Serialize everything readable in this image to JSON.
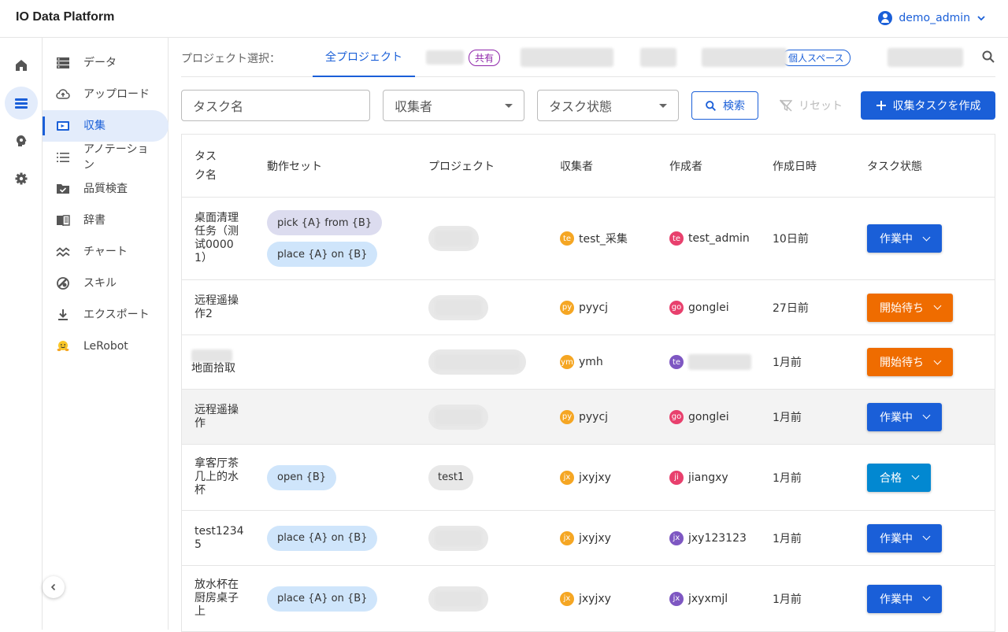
{
  "app": {
    "title": "IO Data Platform",
    "user": "demo_admin"
  },
  "colors": {
    "primary": "#1a5fd8",
    "orange": "#ef6c00",
    "pass": "#0288d1"
  },
  "rail": [
    {
      "name": "home-icon"
    },
    {
      "name": "list-icon"
    },
    {
      "name": "brain-icon"
    },
    {
      "name": "gear-icon"
    }
  ],
  "sidebar": {
    "items": [
      {
        "label": "データ",
        "icon": "storage-icon"
      },
      {
        "label": "アップロード",
        "icon": "cloud-upload-icon"
      },
      {
        "label": "収集",
        "icon": "video-camera-icon"
      },
      {
        "label": "アノテーション",
        "icon": "list-numbered-icon"
      },
      {
        "label": "品質検査",
        "icon": "folder-check-icon"
      },
      {
        "label": "辞書",
        "icon": "book-icon"
      },
      {
        "label": "チャート",
        "icon": "chart-icon"
      },
      {
        "label": "スキル",
        "icon": "skill-icon"
      },
      {
        "label": "エクスポート",
        "icon": "download-icon"
      },
      {
        "label": "LeRobot",
        "icon": "hugging-face-icon"
      }
    ]
  },
  "project_bar": {
    "label": "プロジェクト選択：",
    "all_tab": "全プロジェクト",
    "shared_tag": "共有",
    "personal_tag": "個人スペース"
  },
  "filters": {
    "task_name_placeholder": "タスク名",
    "collector_placeholder": "収集者",
    "status_placeholder": "タスク状態",
    "search_label": "検索",
    "reset_label": "リセット",
    "create_label": "収集タスクを作成"
  },
  "table": {
    "headers": [
      "タスク名",
      "動作セット",
      "プロジェクト",
      "収集者",
      "作成者",
      "作成日時",
      "タスク状態"
    ],
    "rows": [
      {
        "name": "桌面清理任务（测试00001）",
        "actions": [
          "pick {A} from {B}",
          "place {A} on {B}"
        ],
        "project": "",
        "collector_avatar": "te",
        "collector": "test_采集",
        "creator_avatar": "te",
        "creator": "test_admin",
        "date": "10日前",
        "status": "作業中"
      },
      {
        "name": "远程遥操作2",
        "actions": [],
        "project": "",
        "collector_avatar": "py",
        "collector": "pyycj",
        "creator_avatar": "go",
        "creator": "gonglei",
        "date": "27日前",
        "status": "開始待ち"
      },
      {
        "name": "地面拾取",
        "actions": [],
        "project": "",
        "collector_avatar": "ym",
        "collector": "ymh",
        "creator_avatar": "te",
        "creator": "",
        "date": "1月前",
        "status": "開始待ち"
      },
      {
        "name": "远程遥操作",
        "actions": [],
        "project": "",
        "collector_avatar": "py",
        "collector": "pyycj",
        "creator_avatar": "go",
        "creator": "gonglei",
        "date": "1月前",
        "status": "作業中"
      },
      {
        "name": "拿客厅茶几上的水杯",
        "actions": [
          "open {B}"
        ],
        "project": "test1",
        "collector_avatar": "jx",
        "collector": "jxyjxy",
        "creator_avatar": "ji",
        "creator": "jiangxy",
        "date": "1月前",
        "status": "合格"
      },
      {
        "name": "test12345",
        "actions": [
          "place {A} on {B}"
        ],
        "project": "",
        "collector_avatar": "jx",
        "collector": "jxyjxy",
        "creator_avatar": "jx",
        "creator": "jxy123123",
        "date": "1月前",
        "status": "作業中"
      },
      {
        "name": "放水杯在厨房桌子上",
        "actions": [
          "place {A} on {B}"
        ],
        "project": "",
        "collector_avatar": "jx",
        "collector": "jxyjxy",
        "creator_avatar": "jx",
        "creator": "jxyxmjl",
        "date": "1月前",
        "status": "作業中"
      }
    ]
  }
}
